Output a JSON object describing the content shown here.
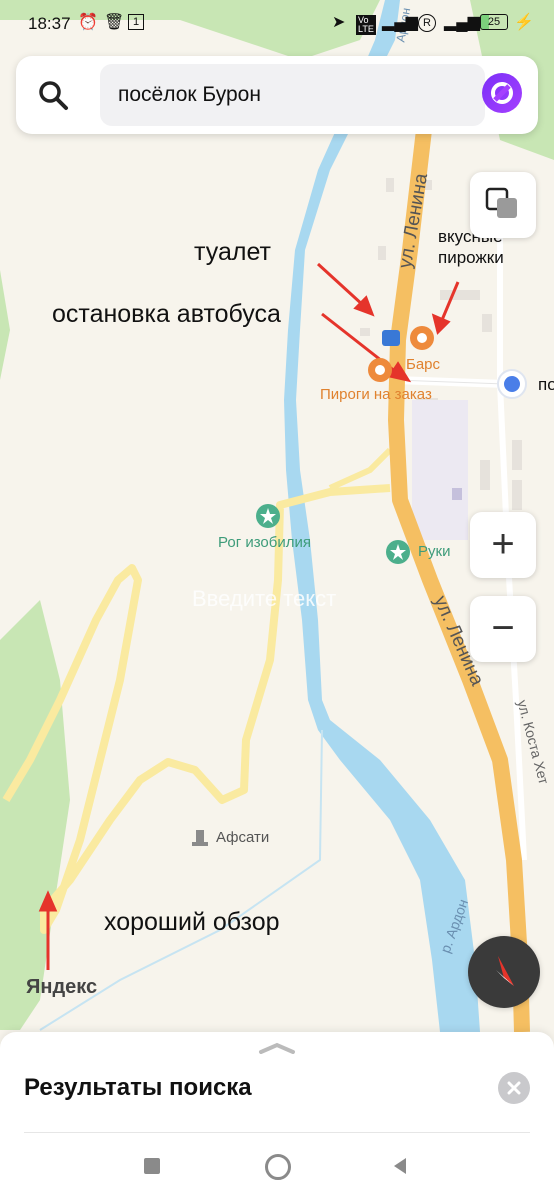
{
  "status_bar": {
    "time": "18:37",
    "battery": "25",
    "icons": [
      "alarm-icon",
      "delete-icon",
      "sim-1-icon",
      "location-icon",
      "volte-icon",
      "signal-icon",
      "roaming-icon",
      "signal-icon",
      "battery-icon",
      "charging-icon"
    ]
  },
  "search": {
    "query": "посёлок Бурон"
  },
  "map": {
    "streets": {
      "lenina_top": "ул. Ленина",
      "lenina_bottom": "ул. Ленина",
      "kosta": "ул. Коста Хет",
      "river": "р. Ардон",
      "river_top": "Ардон"
    },
    "pois": {
      "bars": "Барс",
      "pirogi": "Пироги на заказ",
      "rog": "Рог изобилия",
      "ruki": "Руки",
      "afsati": "Афсати",
      "edge_label": "по"
    },
    "watermark": "Яндекс",
    "ghost_text": "Введите текст",
    "colors": {
      "road": "#f5bf62",
      "road_minor": "#faeaa0",
      "river": "#a8d8f0",
      "forest": "#c8e6b4",
      "poi_orange": "#ee8a3c",
      "poi_green": "#4caf8c",
      "arrow": "#e5342b"
    }
  },
  "annotations": {
    "toilet": "туалет",
    "bus_stop": "остановка автобуса",
    "pies": "вкусные\nпирожки",
    "view": "хороший обзор"
  },
  "controls": {
    "zoom_in": "+",
    "zoom_out": "−"
  },
  "sheet": {
    "title": "Результаты поиска"
  }
}
